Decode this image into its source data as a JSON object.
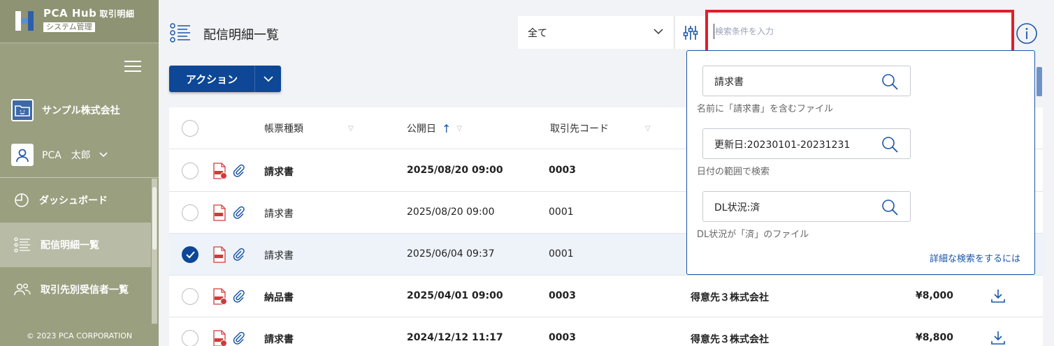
{
  "app": {
    "name": "PCA Hub",
    "name_sub": "取引明細",
    "badge": "システム管理",
    "company": "サンプル株式会社",
    "user": "PCA　太郎",
    "copyright": "© 2023 PCA CORPORATION"
  },
  "nav": [
    {
      "label": "ダッシュボード",
      "icon": "clock-icon",
      "active": false
    },
    {
      "label": "配信明細一覧",
      "icon": "list-icon",
      "active": true
    },
    {
      "label": "取引先別受信者一覧",
      "icon": "users-icon",
      "active": false
    }
  ],
  "page": {
    "title": "配信明細一覧",
    "filter_value": "全て",
    "search_placeholder": "検索条件を入力",
    "action_label": "アクション"
  },
  "table": {
    "headers": [
      "帳票種類",
      "公開日",
      "取引先コード"
    ],
    "rows": [
      {
        "type": "請求書",
        "date": "2025/08/20 09:00",
        "code": "0003",
        "partner": "",
        "amount": "",
        "bold": true,
        "checked": false
      },
      {
        "type": "請求書",
        "date": "2025/08/20 09:00",
        "code": "0001",
        "partner": "",
        "amount": "",
        "bold": false,
        "checked": false
      },
      {
        "type": "請求書",
        "date": "2025/06/04 09:37",
        "code": "0001",
        "partner": "",
        "amount": "",
        "bold": false,
        "checked": true
      },
      {
        "type": "納品書",
        "date": "2025/04/01 09:00",
        "code": "0003",
        "partner": "得意先３株式会社",
        "amount": "¥8,000",
        "bold": true,
        "checked": false
      },
      {
        "type": "請求書",
        "date": "2024/12/12 11:17",
        "code": "0003",
        "partner": "得意先３株式会社",
        "amount": "¥8,800",
        "bold": true,
        "checked": false
      }
    ]
  },
  "suggest": {
    "items": [
      {
        "value": "請求書",
        "hint": "名前に「請求書」を含むファイル"
      },
      {
        "value": "更新日:20230101-20231231",
        "hint": "日付の範囲で検索"
      },
      {
        "value": "DL状況:済",
        "hint": "DL状況が「済」のファイル"
      }
    ],
    "link": "詳細な検索をするには"
  },
  "colors": {
    "sidebar": "#9a9f7f",
    "primary": "#0d4796",
    "highlight_border": "#e01e2a"
  }
}
